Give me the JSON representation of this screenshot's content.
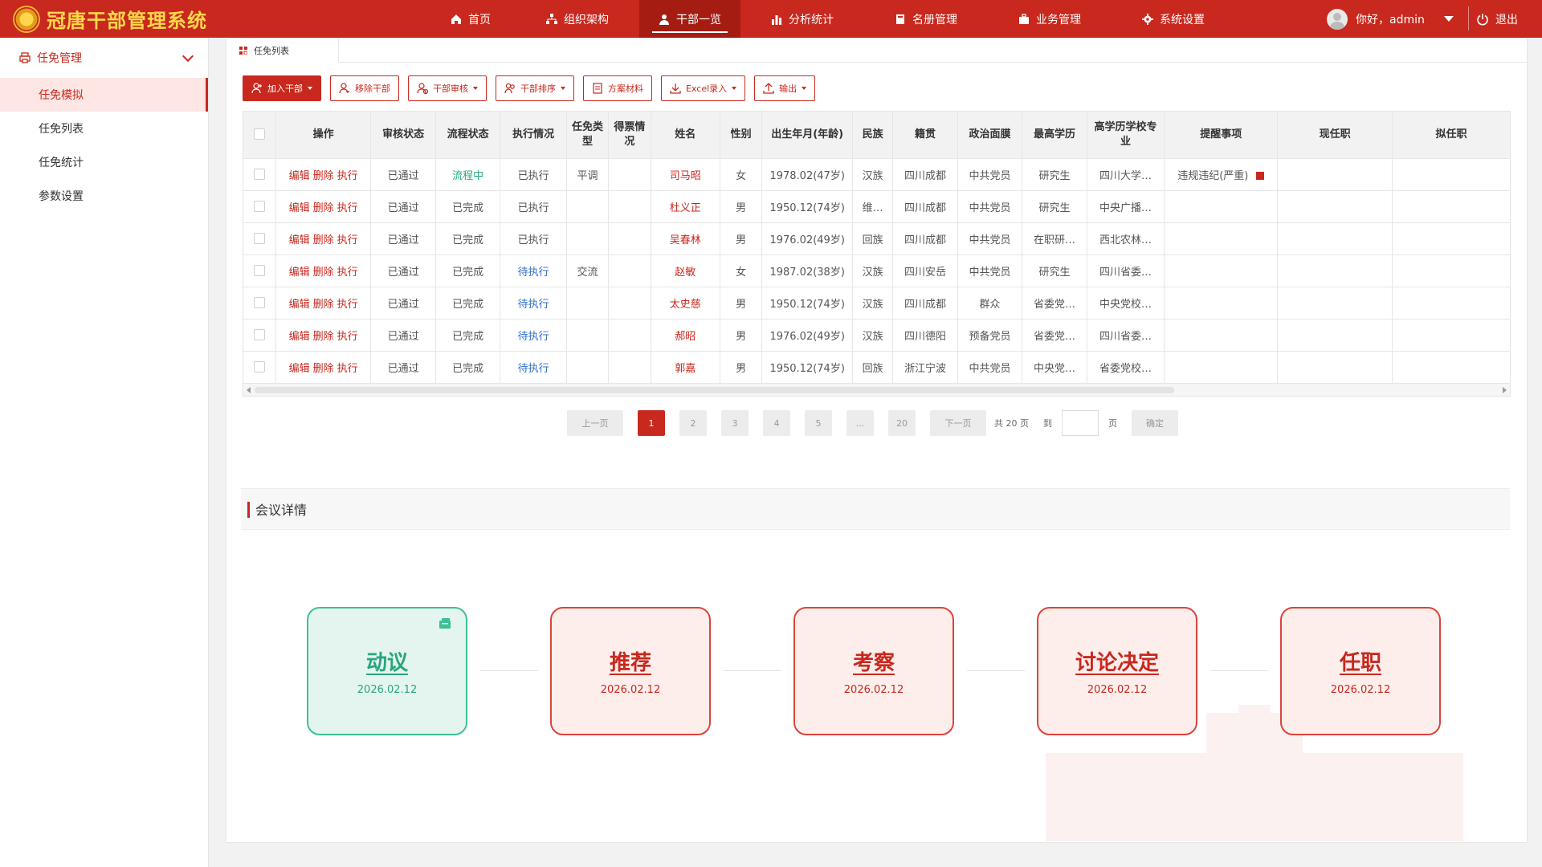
{
  "app": {
    "title": "冠唐干部管理系统"
  },
  "nav": [
    {
      "label": "首页",
      "icon": "home-icon"
    },
    {
      "label": "组织架构",
      "icon": "org-chart-icon"
    },
    {
      "label": "干部一览",
      "icon": "person-icon",
      "active": true
    },
    {
      "label": "分析统计",
      "icon": "bar-chart-icon"
    },
    {
      "label": "名册管理",
      "icon": "book-icon"
    },
    {
      "label": "业务管理",
      "icon": "briefcase-icon"
    },
    {
      "label": "系统设置",
      "icon": "gear-icon"
    }
  ],
  "user": {
    "greeting": "你好，admin",
    "logout": "退出"
  },
  "sidebar": {
    "group": "任免管理",
    "items": [
      {
        "label": "任免模拟",
        "active": true
      },
      {
        "label": "任免列表"
      },
      {
        "label": "任免统计"
      },
      {
        "label": "参数设置"
      }
    ]
  },
  "tab": {
    "label": "任免列表"
  },
  "toolbar": {
    "add": "加入干部",
    "remove": "移除干部",
    "review": "干部审核",
    "sort": "干部排序",
    "materials": "方案材料",
    "excel": "Excel录入",
    "export": "输出"
  },
  "table": {
    "headers": [
      "操作",
      "审核状态",
      "流程状态",
      "执行情况",
      "任免类型",
      "得票情况",
      "姓名",
      "性别",
      "出生年月(年龄)",
      "民族",
      "籍贯",
      "政治面膜",
      "最高学历",
      "高学历学校专业",
      "提醒事项",
      "现任职",
      "拟任职"
    ],
    "op_labels": {
      "edit": "编辑",
      "delete": "删除",
      "execute": "执行"
    },
    "rows": [
      {
        "audit": "已通过",
        "flow": "流程中",
        "exec": "已执行",
        "type": "平调",
        "votes": "",
        "name": "司马昭",
        "gender": "女",
        "birth": "1978.02(47岁)",
        "ethnic": "汉族",
        "origin": "四川成都",
        "party": "中共党员",
        "edu": "研究生",
        "school": "四川大学…",
        "remind": "违规违纪(严重)",
        "current": "",
        "proposed": ""
      },
      {
        "audit": "已通过",
        "flow": "已完成",
        "exec": "已执行",
        "type": "",
        "votes": "",
        "name": "杜义正",
        "gender": "男",
        "birth": "1950.12(74岁)",
        "ethnic": "维…",
        "origin": "四川成都",
        "party": "中共党员",
        "edu": "研究生",
        "school": "中央广播…",
        "remind": "",
        "current": "",
        "proposed": ""
      },
      {
        "audit": "已通过",
        "flow": "已完成",
        "exec": "已执行",
        "type": "",
        "votes": "",
        "name": "吴春林",
        "gender": "男",
        "birth": "1976.02(49岁)",
        "ethnic": "回族",
        "origin": "四川成都",
        "party": "中共党员",
        "edu": "在职研…",
        "school": "西北农林…",
        "remind": "",
        "current": "",
        "proposed": ""
      },
      {
        "audit": "已通过",
        "flow": "已完成",
        "exec": "待执行",
        "type": "交流",
        "votes": "",
        "name": "赵敏",
        "gender": "女",
        "birth": "1987.02(38岁)",
        "ethnic": "汉族",
        "origin": "四川安岳",
        "party": "中共党员",
        "edu": "研究生",
        "school": "四川省委…",
        "remind": "",
        "current": "",
        "proposed": ""
      },
      {
        "audit": "已通过",
        "flow": "已完成",
        "exec": "待执行",
        "type": "",
        "votes": "",
        "name": "太史慈",
        "gender": "男",
        "birth": "1950.12(74岁)",
        "ethnic": "汉族",
        "origin": "四川成都",
        "party": "群众",
        "edu": "省委党…",
        "school": "中央党校…",
        "remind": "",
        "current": "",
        "proposed": ""
      },
      {
        "audit": "已通过",
        "flow": "已完成",
        "exec": "待执行",
        "type": "",
        "votes": "",
        "name": "郝昭",
        "gender": "男",
        "birth": "1976.02(49岁)",
        "ethnic": "汉族",
        "origin": "四川德阳",
        "party": "预备党员",
        "edu": "省委党…",
        "school": "四川省委…",
        "remind": "",
        "current": "",
        "proposed": ""
      },
      {
        "audit": "已通过",
        "flow": "已完成",
        "exec": "待执行",
        "type": "",
        "votes": "",
        "name": "郭嘉",
        "gender": "男",
        "birth": "1950.12(74岁)",
        "ethnic": "回族",
        "origin": "浙江宁波",
        "party": "中共党员",
        "edu": "中央党…",
        "school": "省委党校…",
        "remind": "",
        "current": "",
        "proposed": ""
      }
    ]
  },
  "pager": {
    "prev": "上一页",
    "pages": [
      "1",
      "2",
      "3",
      "4",
      "5",
      "...",
      "20"
    ],
    "current": "1",
    "next": "下一页",
    "total": "共 20 页",
    "goto": "到",
    "page_unit": "页",
    "confirm": "确定"
  },
  "meeting": {
    "title": "会议详情",
    "steps": [
      {
        "name": "动议",
        "date": "2026.02.12",
        "done": true
      },
      {
        "name": "推荐",
        "date": "2026.02.12"
      },
      {
        "name": "考察",
        "date": "2026.02.12"
      },
      {
        "name": "讨论决定",
        "date": "2026.02.12"
      },
      {
        "name": "任职",
        "date": "2026.02.12"
      }
    ]
  },
  "colors": {
    "brand": "#c8281d",
    "done": "#2aa57e",
    "pending": "#2f6ec9"
  }
}
